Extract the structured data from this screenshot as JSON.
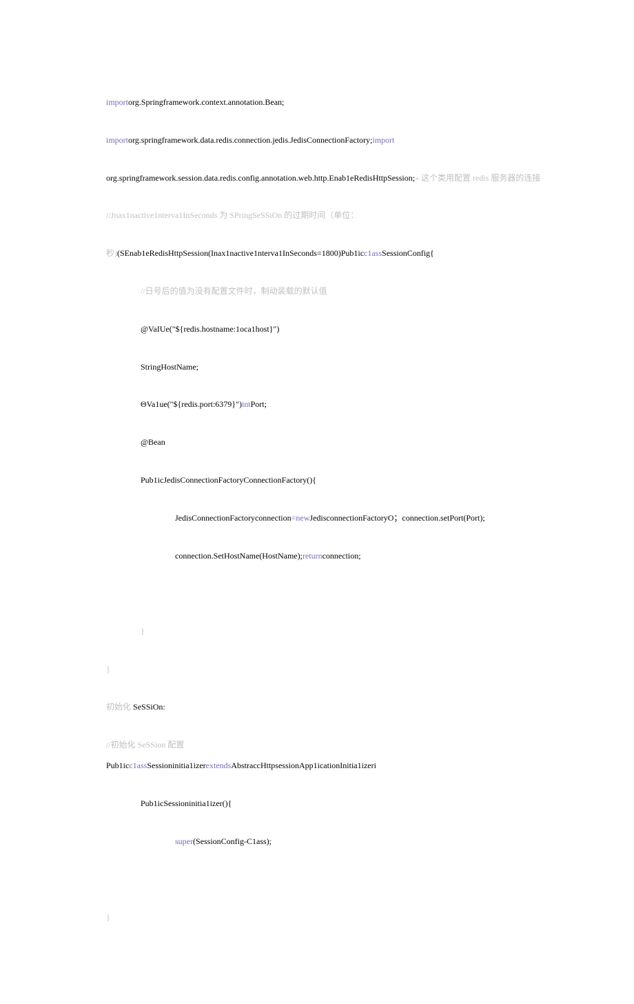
{
  "lines": {
    "l1": {
      "kw": "import",
      "rest": "org.Springframework.context.annotation.Bean;"
    },
    "l2": {
      "kw": "import",
      "rest": "org.springframework.data.redis.connection.jedis.JedisConnectionFactory;",
      "kw2": "import"
    },
    "l3": {
      "pre": "org.springframework.session.data.redis.config.annotation.web.http.Enab1eRedisHttpSession;",
      "c1": "» ",
      "c2": "这个类用配置 redis 服务器的连接"
    },
    "l4": "//Jnax1nactive1nterva1InSeconds 为 SPringSeSSiOn 的过期时间（单位：",
    "l5": {
      "pre": "秒)",
      "rest": "(SEnab1eRedisHttpSession(Inax1nactive1nterva1InSeconds=1800)Pub1ic",
      "kw": "c1ass",
      "rest2": "SessionConfig{"
    },
    "l6": "//日号后的值为没有配置文件时，制动装载的默认值",
    "l7": "@VaIUe(\"${redis.hostname:1oca1host}\")",
    "l8": "StringHostName;",
    "l9": {
      "pre": "ΘVa1ue(\"${redis.port:6379}\")",
      "kw": "int",
      "rest": "Port;"
    },
    "l10": "@Bean",
    "l11": "Pub1icJedisConnectionFactoryConnectionFactory(){",
    "l12": {
      "pre": "JedisConnectionFactoryconnection",
      "eq": "=",
      "kw": "new",
      "rest": "JedisconnectionFactoryO；connection.setPort(Port);"
    },
    "l13": {
      "pre": "connection.SetHostName(HostName);",
      "kw": "return",
      "rest": "connection;"
    },
    "l14": "}",
    "l15": "}",
    "l16": {
      "pre": "初始化 ",
      "rest": "SeSSiOn:"
    },
    "l17": "//初始化 SeSSion 配置",
    "l18": {
      "pre": "Pub1ic",
      "kw": "c1ass",
      "mid": "Sessioninitia1izer",
      "kw2": "extends",
      "rest": "AbstraccHttpsessionApp1icationInitia1izeri"
    },
    "l19": "Pub1icSessioninitia1izer(){",
    "l20": {
      "kw": "super",
      "rest": "(SessionConfig-C1ass);"
    },
    "l21": "}"
  }
}
